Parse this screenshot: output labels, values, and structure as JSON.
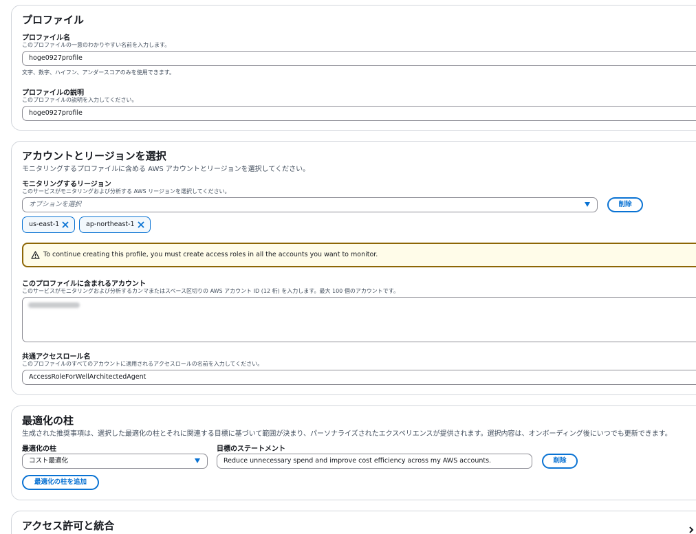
{
  "profile": {
    "heading": "プロファイル",
    "name_label": "プロファイル名",
    "name_desc": "このプロファイルの一意のわかりやすい名前を入力します。",
    "name_value": "hoge0927profile",
    "name_hint": "文字、数字、ハイフン、アンダースコアのみを使用できます。",
    "desc_label": "プロファイルの説明",
    "desc_desc": "このプロファイルの説明を入力してください。",
    "desc_value": "hoge0927profile"
  },
  "accounts_regions": {
    "heading": "アカウントとリージョンを選択",
    "subtitle": "モニタリングするプロファイルに含める AWS アカウントとリージョンを選択してください。",
    "regions_label": "モニタリングするリージョン",
    "regions_desc": "このサービスがモニタリングおよび分析する AWS リージョンを選択してください。",
    "regions_placeholder": "オプションを選択",
    "remove_label": "削除",
    "tokens": [
      "us-east-1",
      "ap-northeast-1"
    ],
    "alert_text": "To continue creating this profile, you must create access roles in all the accounts you want to monitor.",
    "accounts_label": "このプロファイルに含まれるアカウント",
    "accounts_desc": "このサービスがモニタリングおよび分析するカンマまたはスペース区切りの AWS アカウント ID (12 桁) を入力します。最大 100 個のアカウントです。",
    "role_label": "共通アクセスロール名",
    "role_desc": "このプロファイルのすべてのアカウントに適用されるアクセスロールの名前を入力してください。",
    "role_value": "AccessRoleForWellArchitectedAgent"
  },
  "pillars": {
    "heading": "最適化の柱",
    "subtitle": "生成された推奨事項は、選択した最適化の柱とそれに関連する目標に基づいて範囲が決まり、パーソナライズされたエクスペリエンスが提供されます。選択内容は、オンボーディング後にいつでも更新できます。",
    "pillar_label": "最適化の柱",
    "pillar_value": "コスト最適化",
    "goal_label": "目標のステートメント",
    "goal_value": "Reduce unnecessary spend and improve cost efficiency across my AWS accounts.",
    "remove_label": "削除",
    "add_label": "最適化の柱を追加"
  },
  "permissions": {
    "heading": "アクセス許可と統合"
  },
  "colors": {
    "accent": "#0972d3",
    "warning_border": "#8d6605",
    "warning_bg": "#fffce9"
  }
}
